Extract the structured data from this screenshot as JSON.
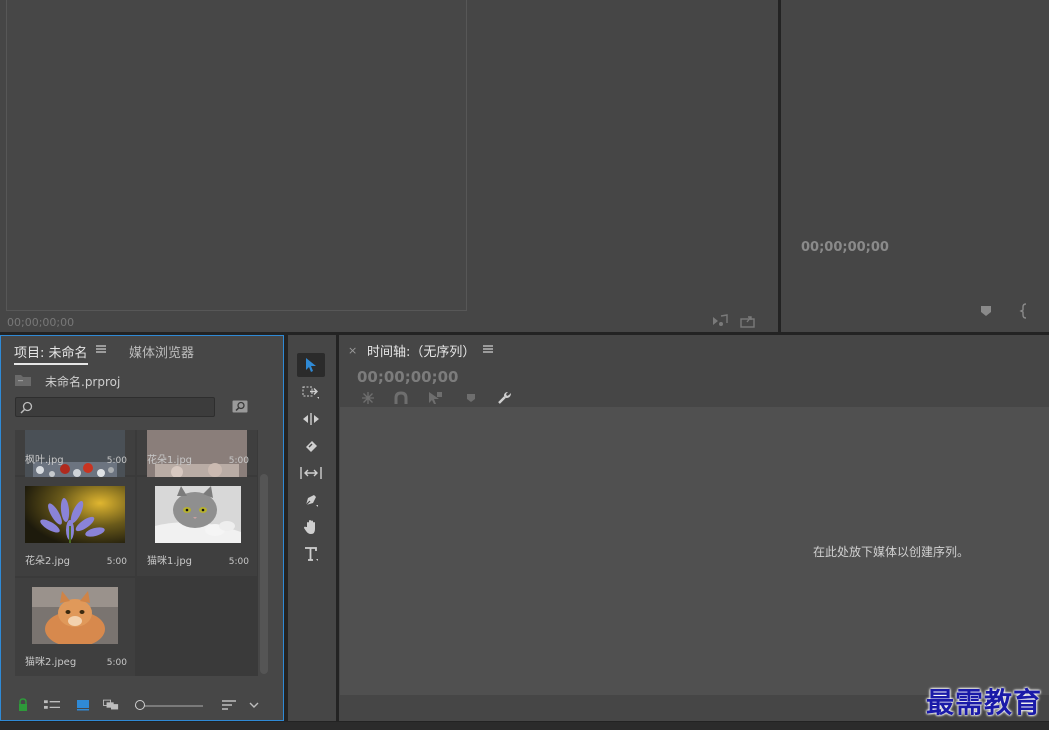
{
  "source_monitor": {
    "timecode": "00;00;00;00"
  },
  "program_monitor": {
    "timecode": "00;00;00;00"
  },
  "project": {
    "tab_label": "项目: 未命名",
    "media_tab_label": "媒体浏览器",
    "file_name": "未命名.prproj",
    "search": {
      "value": "",
      "placeholder": ""
    },
    "items": [
      {
        "name": "枫叶.jpg",
        "duration": "5:00"
      },
      {
        "name": "花朵1.jpg",
        "duration": "5:00"
      },
      {
        "name": "花朵2.jpg",
        "duration": "5:00"
      },
      {
        "name": "猫咪1.jpg",
        "duration": "5:00"
      },
      {
        "name": "猫咪2.jpeg",
        "duration": "5:00"
      }
    ]
  },
  "timeline": {
    "title": "时间轴:（无序列）",
    "timecode": "00;00;00;00",
    "hint": "在此处放下媒体以创建序列。"
  },
  "watermark": "最需教育",
  "colors": {
    "accent": "#2f8ad6",
    "panel": "#464646",
    "drop_area": "#505050"
  }
}
